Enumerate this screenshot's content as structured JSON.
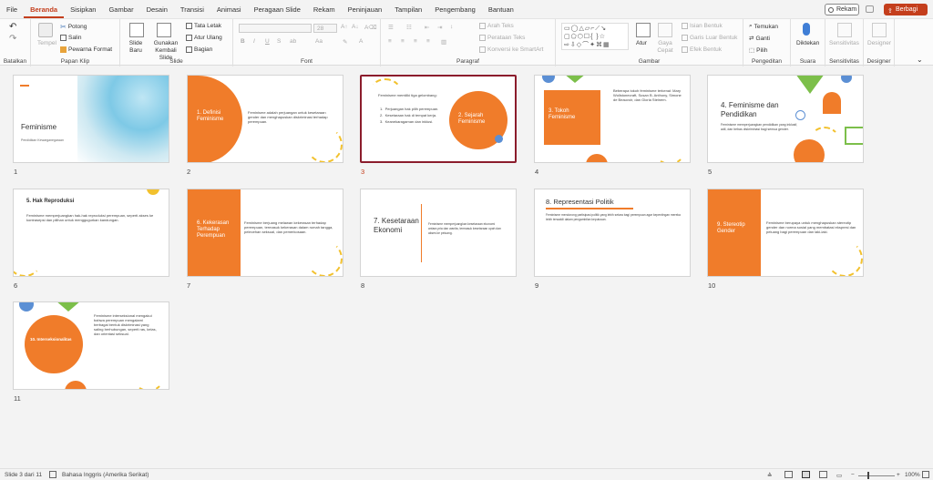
{
  "tabs": [
    "File",
    "Beranda",
    "Sisipkan",
    "Gambar",
    "Desain",
    "Transisi",
    "Animasi",
    "Peragaan Slide",
    "Rekam",
    "Peninjauan",
    "Tampilan",
    "Pengembang",
    "Bantuan"
  ],
  "active_tab": "Beranda",
  "top_buttons": {
    "rekam": "Rekam",
    "berbagi": "Berbagi"
  },
  "ribbon": {
    "groups": {
      "batalkan": "Batalkan",
      "papan_klip": "Papan Klip",
      "slide": "Slide",
      "font": "Font",
      "paragraf": "Paragraf",
      "gambar": "Gambar",
      "pengeditan": "Pengeditan",
      "suara": "Suara",
      "sensitivitas": "Sensitivitas",
      "designer": "Designer"
    },
    "clipboard": {
      "tempel": "Tempel",
      "potong": "Potong",
      "salin": "Salin",
      "pewarna": "Pewarna Format"
    },
    "slides": {
      "baru": "Slide Baru",
      "gunakan": "Gunakan Kembali Slide",
      "tata_letak": "Tata Letak",
      "atur_ulang": "Atur Ulang",
      "bagian": "Bagian"
    },
    "font": {
      "size": "28"
    },
    "paragraph": {
      "arah_teks": "Arah Teks",
      "perataan_teks": "Perataan Teks",
      "konversi": "Konversi ke SmartArt"
    },
    "drawing": {
      "atur": "Atur",
      "gaya_cepat": "Gaya Cepat",
      "isian": "Isian Bentuk",
      "garis": "Garis Luar Bentuk",
      "efek": "Efek Bentuk"
    },
    "editing": {
      "temukan": "Temukan",
      "ganti": "Ganti",
      "pilih": "Pilih"
    },
    "voice": {
      "diktekan": "Diktekan"
    },
    "sensitivity": {
      "label": "Sensitivitas"
    },
    "designer": {
      "label": "Designer"
    }
  },
  "slides": [
    {
      "num": "1",
      "title": "Feminisme",
      "subtitle": "Pendidikan Kewarganegaraan"
    },
    {
      "num": "2",
      "title": "1. Definisi Feminisme",
      "body": "Feminisme adalah perjuangan untuk kesetaraan gender dan menghapuskan diskriminasi terhadap perempuan."
    },
    {
      "num": "3",
      "intro": "Feminisme memiliki tiga gelombang:",
      "items": [
        "Perjuangan hak pilih perempuan.",
        "Kesetaraan hak di tempat kerja.",
        "Keanekaragaman dan inklusi."
      ],
      "title": "2. Sejarah Feminisme"
    },
    {
      "num": "4",
      "title": "3. Tokoh Feminisme",
      "body": "Beberapa tokoh feminisme terkenal: Mary Wollstonecraft, Susan B. Anthony, Simone de Beauvoir, dan Gloria Steinem."
    },
    {
      "num": "5",
      "title": "4. Feminisme dan Pendidikan",
      "body": "Feminisme memperjuangkan pendidikan yang inklusif, adil, dan bebas diskriminasi bagi semua gender."
    },
    {
      "num": "6",
      "title": "5. Hak Reproduksi",
      "body": "Feminisme memperjuangkan hak-hak reproduksi perempuan, seperti akses ke kontrasepsi dan pilihan untuk menggugurkan kandungan."
    },
    {
      "num": "7",
      "title": "6. Kekerasan Terhadap Perempuan",
      "body": "Feminisme berjuang melawan kekerasan terhadap perempuan, termasuk kekerasan dalam rumah tangga, pelecehan seksual, dan pemerkosaan."
    },
    {
      "num": "8",
      "title": "7. Kesetaraan Ekonomi",
      "body": "Feminisme memperjuangkan kesetaraan ekonomi antara pria dan wanita, termasuk kesetaraan upah dan akses ke peluang."
    },
    {
      "num": "9",
      "title": "8. Representasi Politik",
      "body": "Feminisme mendorong partisipasi politik yang lebih setara bagi perempuan agar kepentingan mereka lebih terwakili dalam pengambilan keputusan."
    },
    {
      "num": "10",
      "title": "9. Stereotip Gender",
      "body": "Feminisme berupaya untuk menghapuskan stereotip gender dan norma sosial yang membatasi ekspresi dan peluang bagi perempuan dan laki-laki."
    },
    {
      "num": "11",
      "title": "10. Interseksionalitas",
      "body": "Feminisme interseksional mengakui bahwa perempuan mengalami berbagai bentuk diskriminasi yang saling berhubungan, seperti ras, kelas, dan orientasi seksual."
    }
  ],
  "status": {
    "slide_info": "Slide 3 dari 11",
    "language": "Bahasa Inggris (Amerika Serikat)",
    "zoom": "100%"
  }
}
